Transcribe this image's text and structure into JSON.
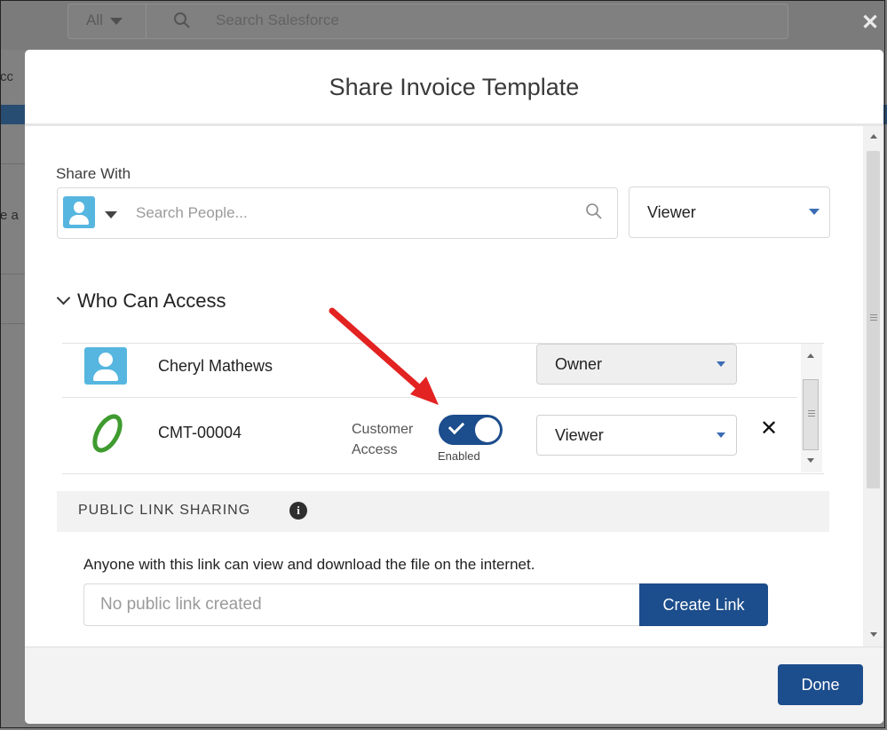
{
  "background": {
    "search_scope": "All",
    "search_placeholder": "Search Salesforce",
    "close_symbol": "✕",
    "left_edge_text_1": "cc",
    "left_edge_text_2": "e a"
  },
  "modal": {
    "title": "Share Invoice Template",
    "share_with": {
      "label": "Share With",
      "search_placeholder": "Search People...",
      "permission": "Viewer"
    },
    "who_can_access": {
      "title": "Who Can Access",
      "entries": [
        {
          "name": "Cheryl Mathews",
          "role": "Owner",
          "icon": "user-icon"
        },
        {
          "name": "CMT-00004",
          "role": "Viewer",
          "icon": "account-logo-icon",
          "access_label_line1": "Customer",
          "access_label_line2": "Access",
          "toggle_state": "Enabled",
          "remove_symbol": "✕"
        }
      ]
    },
    "public_link_sharing": {
      "title": "PUBLIC LINK SHARING",
      "info_symbol": "i",
      "description": "Anyone with this link can view and download the file on the internet.",
      "link_placeholder": "No public link created",
      "create_button": "Create Link"
    },
    "done_button": "Done"
  },
  "colors": {
    "brand_blue": "#1c4d8c",
    "avatar_blue": "#56b6e0",
    "annotation_arrow": "#e32222",
    "logo_green": "#3f9b2f"
  }
}
